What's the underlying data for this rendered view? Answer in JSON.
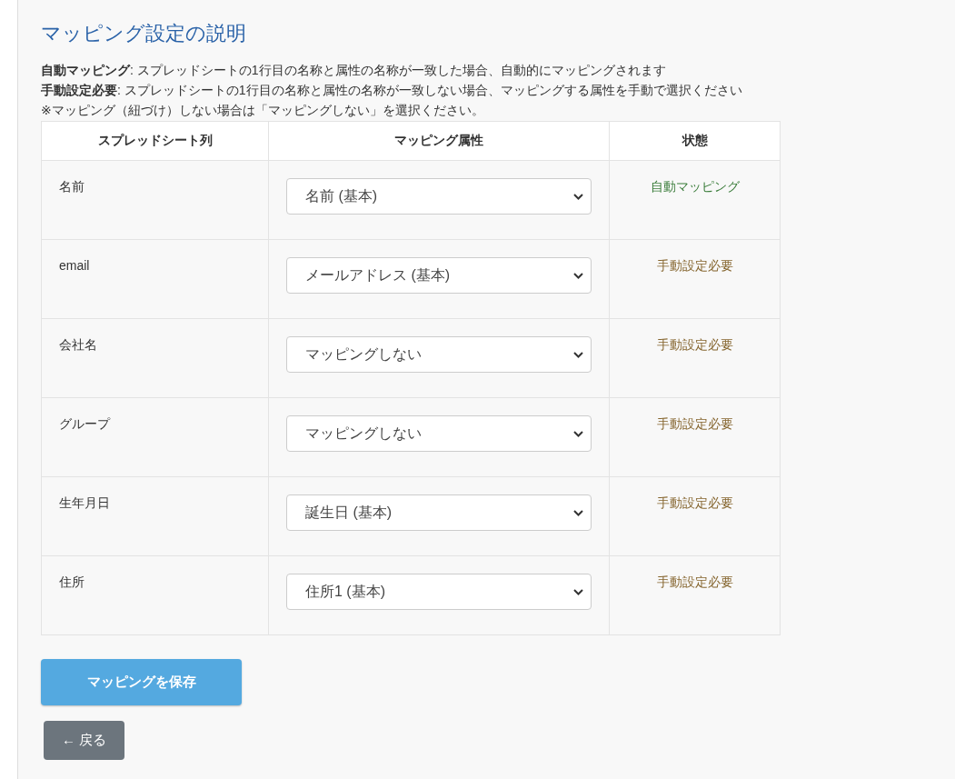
{
  "title": "マッピング設定の説明",
  "notes": [
    "**自動マッピング**: スプレッドシートの1行目の名称と属性の名称が一致した場合、自動的にマッピングされます",
    "**手動設定必要**: スプレッドシートの1行目の名称と属性の名称が一致しない場合、マッピングする属性を手動で選択ください",
    "※マッピング（紐づけ）しない場合は「マッピングしない」を選択ください。"
  ],
  "table": {
    "columns": [
      "スプレッドシート列",
      "マッピング属性",
      "状態"
    ],
    "rows": [
      {
        "column": "名前",
        "attribute": "名前 (基本)",
        "status": {
          "kind": "auto",
          "text": "自動マッピング"
        }
      },
      {
        "column": "email",
        "attribute": "メールアドレス (基本)",
        "status": {
          "kind": "manual",
          "text": "手動設定必要"
        }
      },
      {
        "column": "会社名",
        "attribute": "マッピングしない",
        "status": {
          "kind": "manual",
          "text": "手動設定必要"
        }
      },
      {
        "column": "グループ",
        "attribute": "マッピングしない",
        "status": {
          "kind": "manual",
          "text": "手動設定必要"
        }
      },
      {
        "column": "生年月日",
        "attribute": "誕生日 (基本)",
        "status": {
          "kind": "manual",
          "text": "手動設定必要"
        }
      },
      {
        "column": "住所",
        "attribute": "住所1 (基本)",
        "status": {
          "kind": "manual",
          "text": "手動設定必要"
        }
      }
    ]
  },
  "save_button": "マッピングを保存",
  "back_button": "← 戻る"
}
